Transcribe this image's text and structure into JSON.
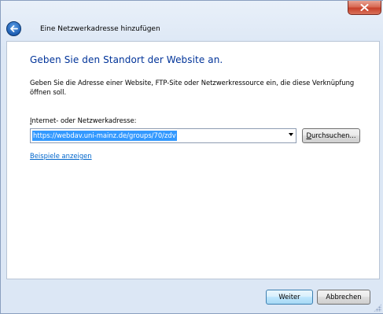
{
  "window": {
    "title": "Eine Netzwerkadresse hinzufügen",
    "close_icon": "close-icon",
    "back_icon": "back-arrow-icon"
  },
  "main": {
    "heading": "Geben Sie den Standort der Website an.",
    "description": "Geben Sie die Adresse einer Website, FTP-Site oder Netzwerkressource ein, die diese Verknüpfung öffnen soll.",
    "address_label_prefix": "I",
    "address_label_rest": "nternet- oder Netzwerkadresse:",
    "address_value": "https://webdav.uni-mainz.de/groups/70/zdv",
    "browse_button_prefix": "D",
    "browse_button_rest": "urchsuchen...",
    "examples_link": "Beispiele anzeigen"
  },
  "footer": {
    "next_button": "Weiter",
    "cancel_button": "Abbrechen"
  },
  "colors": {
    "heading": "#003399",
    "link": "#0066cc",
    "selection": "#3399ff",
    "close_button": "#c7412b"
  }
}
